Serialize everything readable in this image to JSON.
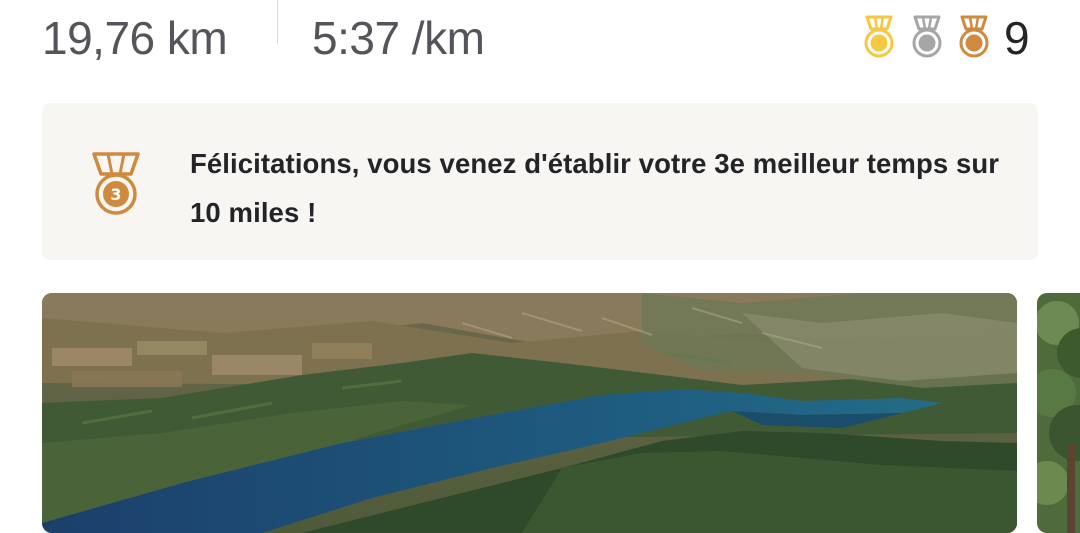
{
  "stats": {
    "distance": "19,76 km",
    "pace": "5:37 /km"
  },
  "medals": {
    "icons": [
      "gold-medal-icon",
      "silver-medal-icon",
      "bronze-medal-icon"
    ],
    "count": "9",
    "colors": {
      "gold": "#f5c842",
      "silver": "#a6a6a8",
      "bronze": "#cf8a3e"
    }
  },
  "achievement": {
    "icon": "bronze-medal-3-icon",
    "rank_badge": "3",
    "text": "Félicitations, vous venez d'établir votre 3e meilleur temps sur 10 miles !"
  },
  "photos": [
    {
      "type": "3D terrain map of lake and hills"
    },
    {
      "type": "photo of trees"
    }
  ],
  "colors": {
    "text_primary": "#242428",
    "text_secondary": "#55545a",
    "card_background": "#f7f6f3"
  }
}
